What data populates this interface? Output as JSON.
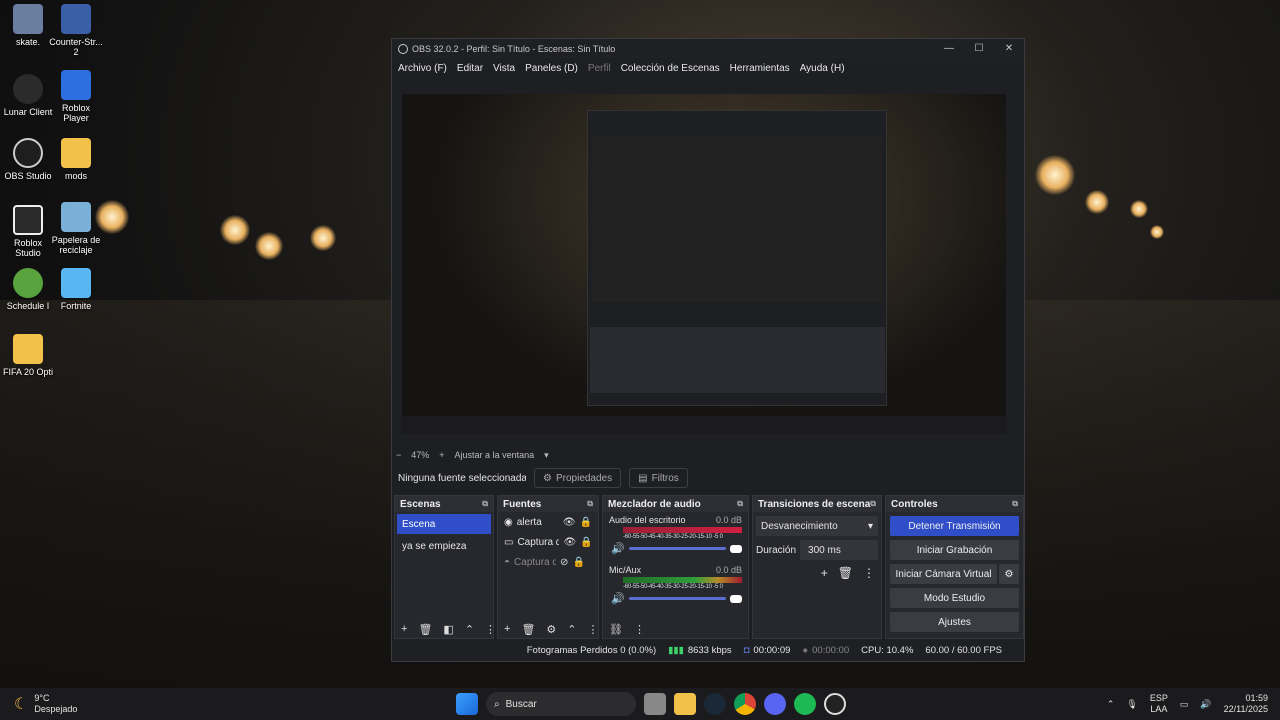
{
  "desktop": {
    "icons": [
      {
        "label": "skate.",
        "color": "#6a7ea0"
      },
      {
        "label": "Counter-Str... 2",
        "color": "#3a5fa8"
      },
      {
        "label": "Lunar Client",
        "color": "#2b2b2b"
      },
      {
        "label": "Roblox Player",
        "color": "#2d6fe0"
      },
      {
        "label": "OBS Studio",
        "color": "#1e1e1e"
      },
      {
        "label": "mods",
        "color": "#f1c14a"
      },
      {
        "label": "Roblox Studio",
        "color": "#2a2a2a"
      },
      {
        "label": "Papelera de reciclaje",
        "color": "#7ab0d8"
      },
      {
        "label": "Schedule I",
        "color": "#58a33e"
      },
      {
        "label": "Fortnite",
        "color": "#58b6f0"
      },
      {
        "label": "FIFA 20 Opti",
        "color": "#f1c14a"
      }
    ]
  },
  "window": {
    "title": "OBS 32.0.2 - Perfil: Sin Título - Escenas: Sin Título",
    "menu": [
      "Archivo (F)",
      "Editar",
      "Vista",
      "Paneles (D)",
      "Perfil",
      "Colección de Escenas",
      "Herramientas",
      "Ayuda (H)"
    ],
    "controls": [
      "—",
      "☐",
      "✕"
    ]
  },
  "preview": {
    "zoom": "47%",
    "fit_label": "Ajustar a la ventana"
  },
  "sourcebar": {
    "no_source": "Ninguna fuente seleccionada",
    "properties": "Propiedades",
    "filters": "Filtros"
  },
  "scenes": {
    "title": "Escenas",
    "items": [
      "Escena",
      "ya se empieza"
    ],
    "selected": 0
  },
  "sources": {
    "title": "Fuentes",
    "items": [
      {
        "name": "alerta",
        "visible": true,
        "locked": false
      },
      {
        "name": "Captura de pantalla",
        "visible": true,
        "locked": false
      },
      {
        "name": "Captura de juego",
        "visible": false,
        "locked": false
      }
    ]
  },
  "mixer": {
    "title": "Mezclador de audio",
    "channels": [
      {
        "name": "Audio del escritorio",
        "db": "0.0 dB",
        "meter_color": "#d02040"
      },
      {
        "name": "Mic/Aux",
        "db": "0.0 dB",
        "meter_color": "#2f9e3a"
      }
    ],
    "scale": "-60-55-50-45-40-35-30-25-20-15-10 -5 0"
  },
  "transitions": {
    "title": "Transiciones de escena",
    "type": "Desvanecimiento",
    "duration_label": "Duración",
    "duration": "300 ms"
  },
  "controls": {
    "title": "Controles",
    "buttons": [
      "Detener Transmisión",
      "Iniciar Grabación",
      "Iniciar Cámara Virtual",
      "Modo Estudio",
      "Ajustes"
    ]
  },
  "status": {
    "dropped": "Fotogramas Perdidos 0 (0.0%)",
    "bitrate": "8633 kbps",
    "stream_time": "00:00:09",
    "rec_time": "00:00:00",
    "cpu": "CPU: 10.4%",
    "fps": "60.00 / 60.00 FPS"
  },
  "taskbar": {
    "weather_temp": "9°C",
    "weather_desc": "Despejado",
    "search": "Buscar",
    "lang1": "ESP",
    "lang2": "LAA",
    "time": "01:59",
    "date": "22/11/2025"
  }
}
